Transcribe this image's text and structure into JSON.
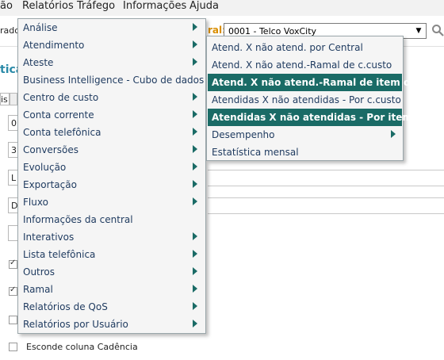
{
  "menubar": {
    "items": [
      "ão",
      "Relatórios",
      "Tráfego",
      "Informações",
      "Ajuda"
    ]
  },
  "toolbar": {
    "left_text": "rado",
    "central_label": "ral:",
    "central_value": "0001 - Telco VoxCity"
  },
  "background": {
    "title": "tica",
    "tab_label": "is",
    "fields": [
      "0",
      "3",
      "L",
      "D"
    ],
    "last_checkbox_label": "Esconde coluna Cadência"
  },
  "menu": {
    "items": [
      {
        "label": "Análise",
        "has_submenu": true
      },
      {
        "label": "Atendimento",
        "has_submenu": true
      },
      {
        "label": "Ateste",
        "has_submenu": true
      },
      {
        "label": "Business Intelligence - Cubo de dados",
        "has_submenu": false
      },
      {
        "label": "Centro de custo",
        "has_submenu": true
      },
      {
        "label": "Conta corrente",
        "has_submenu": true
      },
      {
        "label": "Conta telefônica",
        "has_submenu": true
      },
      {
        "label": "Conversões",
        "has_submenu": true
      },
      {
        "label": "Evolução",
        "has_submenu": true
      },
      {
        "label": "Exportação",
        "has_submenu": true
      },
      {
        "label": "Fluxo",
        "has_submenu": true
      },
      {
        "label": "Informações da central",
        "has_submenu": false
      },
      {
        "label": "Interativos",
        "has_submenu": true
      },
      {
        "label": "Lista telefônica",
        "has_submenu": true
      },
      {
        "label": "Outros",
        "has_submenu": true
      },
      {
        "label": "Ramal",
        "has_submenu": true
      },
      {
        "label": "Relatórios de QoS",
        "has_submenu": true
      },
      {
        "label": "Relatórios por Usuário",
        "has_submenu": true
      }
    ]
  },
  "submenu": {
    "items": [
      {
        "label": "Atend. X não atend. por Central",
        "highlighted": false,
        "has_submenu": false
      },
      {
        "label": "Atend. X não atend.-Ramal de c.custo",
        "highlighted": false,
        "has_submenu": false
      },
      {
        "label": "Atend. X não atend.-Ramal de item org.",
        "highlighted": true,
        "has_submenu": false
      },
      {
        "label": "Atendidas X não atendidas - Por c.custo",
        "highlighted": false,
        "has_submenu": false
      },
      {
        "label": "Atendidas X não atendidas - Por item",
        "highlighted": true,
        "has_submenu": false
      },
      {
        "label": "Desempenho",
        "highlighted": false,
        "has_submenu": true
      },
      {
        "label": "Estatística mensal",
        "highlighted": false,
        "has_submenu": false
      }
    ]
  },
  "colors": {
    "highlight": "#1a6b66",
    "menu_text": "#1e3a5f",
    "central_label": "#d98e00",
    "title": "#2a8aa8"
  }
}
